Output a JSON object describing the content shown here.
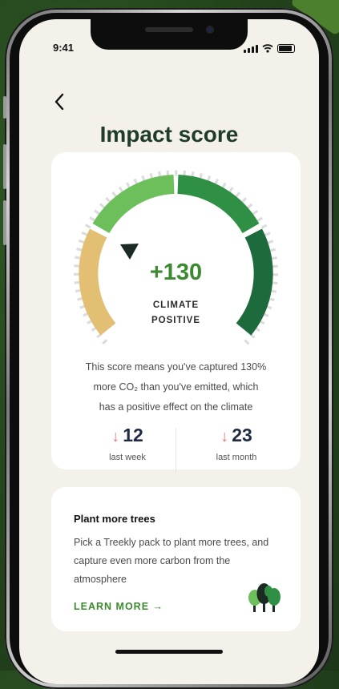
{
  "status_bar": {
    "time": "9:41"
  },
  "header": {
    "title": "Impact score"
  },
  "score_card": {
    "score": "+130",
    "label_line1": "CLIMATE",
    "label_line2": "POSITIVE",
    "description_line1": "This score means you've captured 130%",
    "description_line2": "more CO₂ than you've emitted, which",
    "description_line3": "has a positive effect on the climate",
    "stats": [
      {
        "value": "12",
        "label": "last week",
        "trend": "down"
      },
      {
        "value": "23",
        "label": "last month",
        "trend": "down"
      }
    ],
    "gauge_segments": [
      "#e2bf72",
      "#6dbf5b",
      "#2f8f45",
      "#1d6b3c"
    ],
    "trend_color": "#e87b72"
  },
  "promo_card": {
    "title": "Plant more trees",
    "body": "Pick a Treekly pack to plant more trees, and capture even more carbon from the atmosphere",
    "cta": "LEARN MORE →",
    "icon": "trees-icon"
  },
  "colors": {
    "accent": "#3b8a2f",
    "title": "#1f3b2a",
    "background": "#f3f1ea"
  }
}
